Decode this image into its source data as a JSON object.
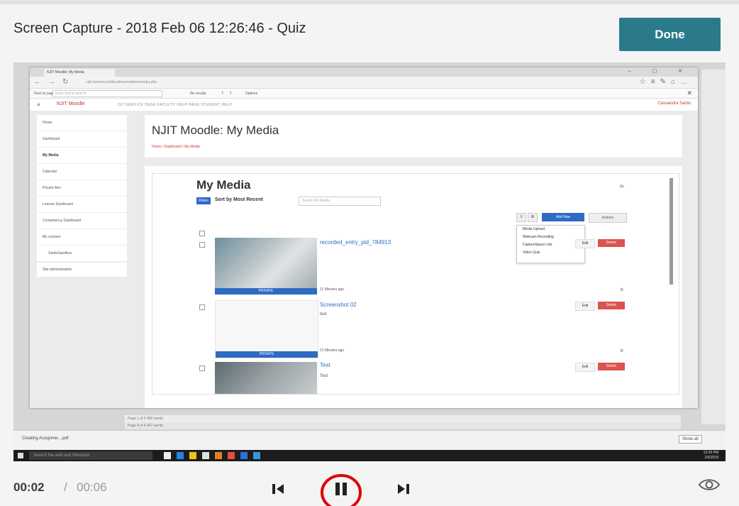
{
  "header": {
    "title": "Screen Capture - 2018 Feb 06 12:26:46 - Quiz",
    "done_label": "Done"
  },
  "browser": {
    "tab_title": "NJIT Moodle: My Media",
    "window_controls": "– ▢ ✕",
    "address": "njit.mrooms.net/local/mymedia/mymedia.php",
    "find_label": "Find on page",
    "find_placeholder": "Enter text to search",
    "find_results": "No results",
    "find_options": "Options"
  },
  "moodle": {
    "logo": "NJIT Moodle",
    "nav_links": "IST SERVICE DESK    FACULTY HELP PAGE    STUDENT HELP",
    "user": "Cassandra Sardo",
    "side_items": [
      "Home",
      "Dashboard",
      "My Media",
      "Calendar",
      "Private files",
      "Learner Dashboard",
      "Competency Dashboard",
      "My courses",
      "SardoSandbox"
    ],
    "side_admin": "Site administration",
    "page_title": "NJIT Moodle: My Media",
    "breadcrumb": "Home / Dashboard / My Media"
  },
  "mymedia": {
    "title": "My Media",
    "filters": "Filters",
    "sort": "Sort by Most Recent",
    "search_placeholder": "Search My Media",
    "add_new": "Add New",
    "actions": "Actions",
    "menu": [
      "Media Upload",
      "Webcam Recording",
      "CaptureSpace Lite",
      "Video Quiz"
    ],
    "private": "PRIVATE",
    "edit": "Edit",
    "delete": "Delete",
    "entries": [
      {
        "title": "recorded_entry_pid_784913",
        "desc": "",
        "meta": "11 Minutes ago"
      },
      {
        "title": "Screenshot 02",
        "desc": "test",
        "meta": "21 Minutes ago"
      },
      {
        "title": "Test",
        "desc": "Test",
        "meta": ""
      }
    ]
  },
  "word": {
    "status1": "Page 1 of 3   450 words",
    "status2": "Page 4 of 4   497 words"
  },
  "downloads": {
    "item": "Creating Assignme....pdf",
    "show_all": "Show all"
  },
  "taskbar": {
    "search": "Search the web and Windows",
    "clock_time": "12:26 PM",
    "clock_date": "2/6/2018"
  },
  "player": {
    "current_time": "00:02",
    "separator": "/",
    "duration": "00:06"
  },
  "colors": {
    "done_bg": "#2a7a8c",
    "highlight_circle": "#e00000",
    "moodle_blue": "#2d6bc4",
    "moodle_red": "#c0392b"
  }
}
